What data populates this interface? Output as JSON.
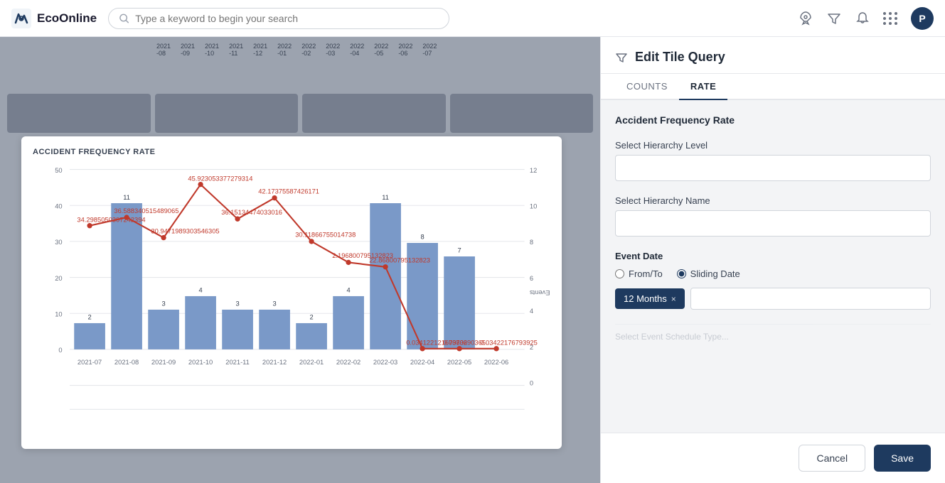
{
  "topnav": {
    "logo_text": "EcoOnline",
    "search_placeholder": "Type a keyword to begin your search",
    "avatar_letter": "P",
    "icons": [
      "rocket-icon",
      "filter-icon",
      "bell-icon",
      "grid-icon"
    ]
  },
  "background": {
    "month_labels": [
      "2021-08",
      "2021-09",
      "2021-10",
      "2021-11",
      "2021-12",
      "2022-01",
      "2022-02",
      "2022-03",
      "2022-04",
      "2022-05",
      "2022-06",
      "2022-07"
    ]
  },
  "chart": {
    "title": "ACCIDENT FREQUENCY RATE",
    "bars": [
      {
        "month": "2021-07",
        "count": 2,
        "height": 40
      },
      {
        "month": "2021-08",
        "count": 11,
        "height": 195
      },
      {
        "month": "2021-09",
        "count": 3,
        "height": 65
      },
      {
        "month": "2021-10",
        "count": 4,
        "height": 80
      },
      {
        "month": "2021-11",
        "count": 3,
        "height": 65
      },
      {
        "month": "2021-12",
        "count": 3,
        "height": 65
      },
      {
        "month": "2022-01",
        "count": 2,
        "height": 40
      },
      {
        "month": "2022-02",
        "count": 4,
        "height": 80
      },
      {
        "month": "2022-03",
        "count": 11,
        "height": 195
      },
      {
        "month": "2022-04",
        "count": 8,
        "height": 145
      },
      {
        "month": "2022-05",
        "count": 7,
        "height": 125
      }
    ],
    "line_points": [
      {
        "month": "2021-07",
        "value": "34.29",
        "y_val": 34.29
      },
      {
        "month": "2021-08",
        "value": "36.58",
        "y_val": 36.58
      },
      {
        "month": "2021-09",
        "value": "30.94",
        "y_val": 30.94
      },
      {
        "month": "2021-10",
        "value": "45.92",
        "y_val": 45.92
      },
      {
        "month": "2021-11",
        "value": "36.15",
        "y_val": 36.15
      },
      {
        "month": "2021-12",
        "value": "42.17",
        "y_val": 42.17
      },
      {
        "month": "2022-01",
        "value": "30.11",
        "y_val": 30.11
      },
      {
        "month": "2022-02",
        "value": "24.19",
        "y_val": 24.19
      },
      {
        "month": "2022-03",
        "value": "22.86",
        "y_val": 22.86
      },
      {
        "month": "2022-04",
        "value": "0.034",
        "y_val": 0.034
      },
      {
        "month": "2022-05",
        "value": "0.034",
        "y_val": 0.034
      },
      {
        "month": "2022-06",
        "value": "0.034",
        "y_val": 0.034
      }
    ],
    "y_left_max": 50,
    "y_right_max": 12,
    "right_axis_label": "All Events"
  },
  "panel": {
    "title": "Edit Tile Query",
    "tabs": [
      "COUNTS",
      "RATE"
    ],
    "active_tab": "RATE",
    "section": "Accident Frequency Rate",
    "hierarchy_level_label": "Select Hierarchy Level",
    "hierarchy_level_value": "",
    "hierarchy_name_label": "Select Hierarchy Name",
    "hierarchy_name_value": "",
    "event_date_label": "Event Date",
    "from_to_label": "From/To",
    "sliding_date_label": "Sliding Date",
    "sliding_date_selected": true,
    "date_pill": "12 Months",
    "date_pill_close": "×",
    "cancel_label": "Cancel",
    "save_label": "Save"
  }
}
